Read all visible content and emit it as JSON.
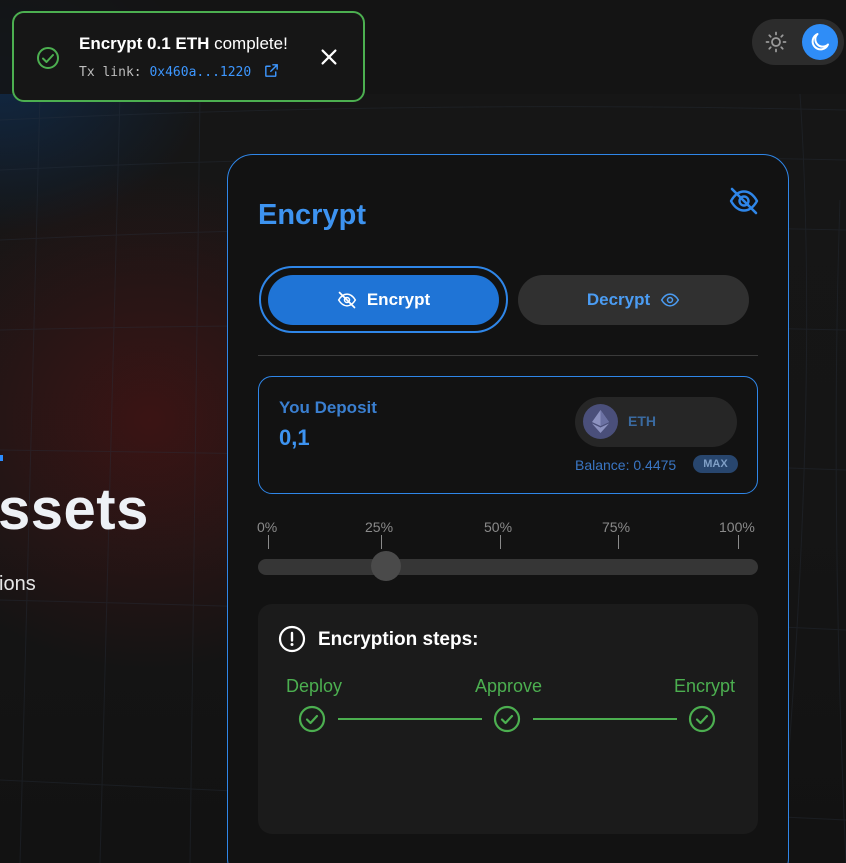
{
  "toast": {
    "title_strong": "Encrypt 0.1 ETH",
    "title_rest": " complete!",
    "link_label": "Tx link: ",
    "tx_hash": "0x460a...1220"
  },
  "theme": {
    "active": "dark"
  },
  "hero": {
    "title_fragment": "ssets",
    "subtitle_fragment": "ions"
  },
  "card": {
    "title": "Encrypt",
    "tabs": [
      {
        "label": "Encrypt",
        "active": true
      },
      {
        "label": "Decrypt",
        "active": false
      }
    ],
    "deposit": {
      "label": "You Deposit",
      "value": "0,1",
      "token": "ETH",
      "balance": "Balance: 0.4475",
      "max_label": "MAX"
    },
    "slider": {
      "marks": [
        "0%",
        "25%",
        "50%",
        "75%",
        "100%"
      ],
      "value_percent": 25
    },
    "steps": {
      "title": "Encryption steps:",
      "items": [
        {
          "label": "Deploy",
          "done": true
        },
        {
          "label": "Approve",
          "done": true
        },
        {
          "label": "Encrypt",
          "done": true
        }
      ]
    }
  },
  "colors": {
    "accent": "#2f86e8",
    "success": "#4caf50",
    "background": "#141414"
  }
}
